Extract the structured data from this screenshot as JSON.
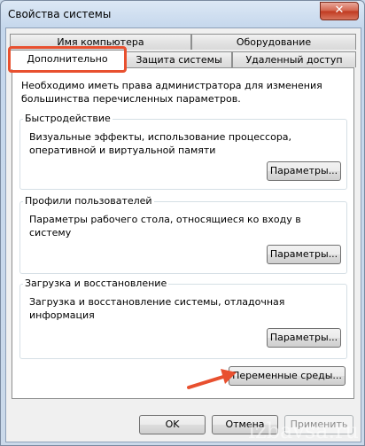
{
  "window": {
    "title": "Свойства системы",
    "close_glyph": "✕"
  },
  "tabs": {
    "computer_name": "Имя компьютера",
    "hardware": "Оборудование",
    "advanced": "Дополнительно",
    "system_protection": "Защита системы",
    "remote_access": "Удаленный доступ"
  },
  "advanced": {
    "intro": "Необходимо иметь права администратора для изменения большинства перечисленных параметров.",
    "performance": {
      "title": "Быстродействие",
      "desc": "Визуальные эффекты, использование процессора, оперативной и виртуальной памяти",
      "button": "Параметры..."
    },
    "user_profiles": {
      "title": "Профили пользователей",
      "desc": "Параметры рабочего стола, относящиеся ко входу в систему",
      "button": "Параметры..."
    },
    "startup_recovery": {
      "title": "Загрузка и восстановление",
      "desc": "Загрузка и восстановление системы, отладочная информация",
      "button": "Параметры..."
    },
    "env_vars_button": "Переменные среды..."
  },
  "footer": {
    "ok": "OK",
    "cancel": "Отмена",
    "apply": "Применить"
  },
  "annotation": {
    "accent_color": "#e8502f"
  },
  "watermark": "izbavsa.ru"
}
